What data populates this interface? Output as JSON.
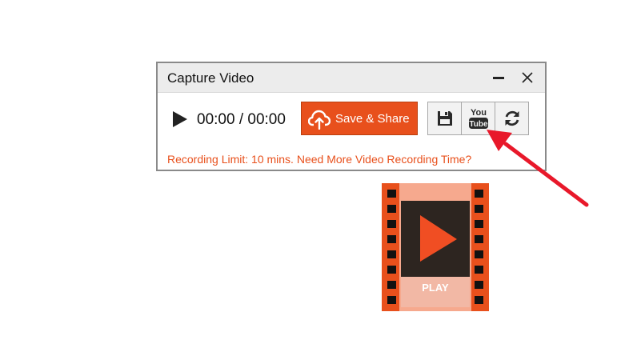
{
  "dialog": {
    "title": "Capture Video",
    "time_display": "00:00 / 00:00",
    "save_share_label": "Save & Share",
    "limit_text": "Recording Limit: 10 mins. Need More Video Recording Time?"
  },
  "tools": {
    "youtube_top": "You",
    "youtube_bottom": "Tube"
  },
  "video_logo": {
    "label": "PLAY"
  },
  "icons": {
    "minimize": "minimize-icon",
    "close": "close-icon",
    "play": "play-icon",
    "cloud_upload": "cloud-upload-icon",
    "save": "floppy-disk-icon",
    "youtube": "youtube-icon",
    "refresh": "refresh-icon"
  },
  "colors": {
    "accent": "#e8501c",
    "arrow": "#e8182a"
  }
}
